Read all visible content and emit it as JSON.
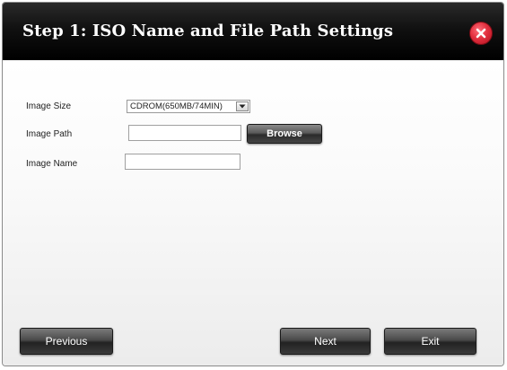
{
  "dialog": {
    "title": "Step 1: ISO Name and File Path Settings",
    "close_icon": "close-x-icon",
    "close_color": "#e3303f"
  },
  "form": {
    "image_size": {
      "label": "Image Size",
      "selected": "CDROM(650MB/74MIN)"
    },
    "image_path": {
      "label": "Image Path",
      "value": "",
      "browse_label": "Browse"
    },
    "image_name": {
      "label": "Image Name",
      "value": ""
    }
  },
  "footer": {
    "previous_label": "Previous",
    "next_label": "Next",
    "exit_label": "Exit"
  }
}
